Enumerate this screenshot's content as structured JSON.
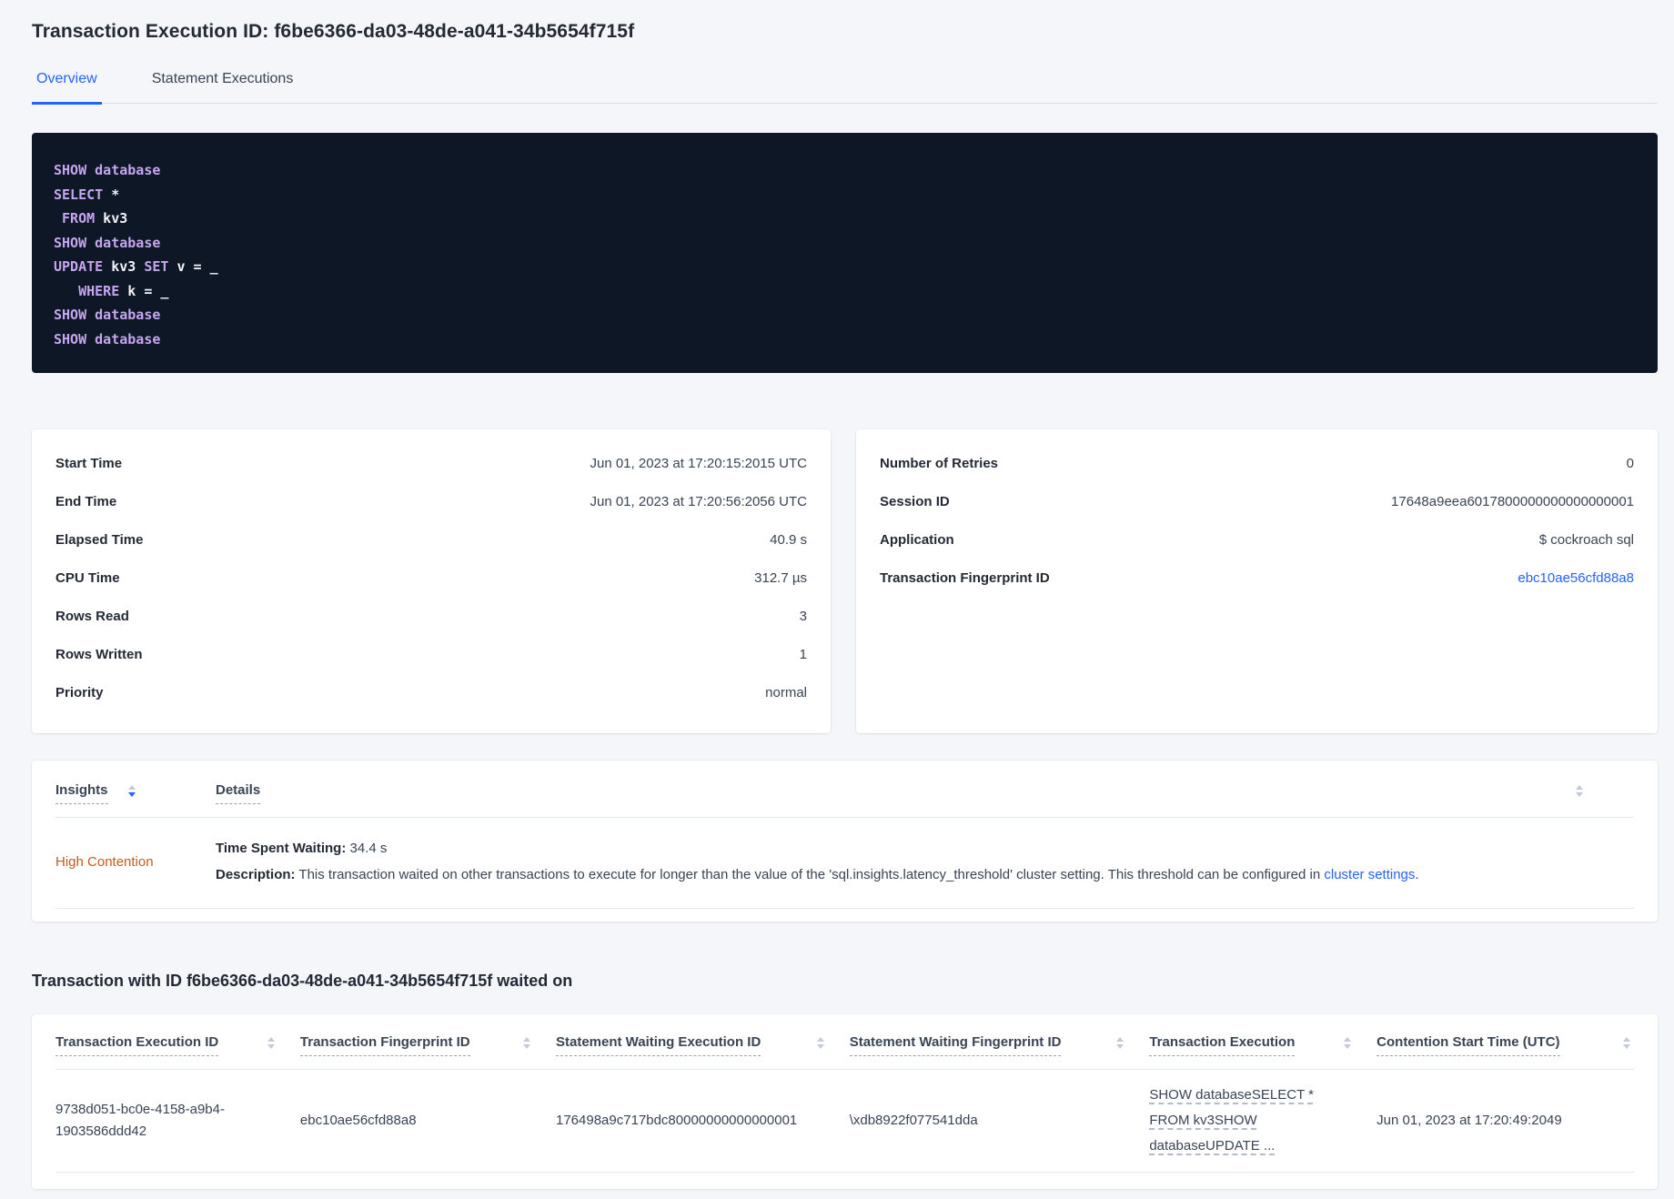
{
  "colors": {
    "accent": "#2562ff",
    "warning": "#c25c18",
    "code_bg": "#0e1726",
    "code_keyword": "#c6a5f1",
    "code_plain": "#f5f3fa"
  },
  "page": {
    "title": "Transaction Execution ID: f6be6366-da03-48de-a041-34b5654f715f",
    "tabs": [
      {
        "label": "Overview"
      },
      {
        "label": "Statement Executions"
      }
    ]
  },
  "sql": {
    "lines": [
      [
        {
          "t": "SHOW ",
          "k": 1
        },
        {
          "t": "database",
          "k": 1
        }
      ],
      [
        {
          "t": "SELECT",
          "k": 1
        },
        {
          "t": " *"
        }
      ],
      [
        {
          "t": " "
        },
        {
          "t": "FROM",
          "k": 1
        },
        {
          "t": " kv3"
        }
      ],
      [
        {
          "t": "SHOW ",
          "k": 1
        },
        {
          "t": "database",
          "k": 1
        }
      ],
      [
        {
          "t": "UPDATE",
          "k": 1
        },
        {
          "t": " kv3 "
        },
        {
          "t": "SET",
          "k": 1
        },
        {
          "t": " v = _"
        }
      ],
      [
        {
          "t": "   "
        },
        {
          "t": "WHERE",
          "k": 1
        },
        {
          "t": " k = _"
        }
      ],
      [
        {
          "t": "SHOW ",
          "k": 1
        },
        {
          "t": "database",
          "k": 1
        }
      ],
      [
        {
          "t": "SHOW ",
          "k": 1
        },
        {
          "t": "database",
          "k": 1
        }
      ]
    ]
  },
  "summary_left": {
    "rows": [
      {
        "label": "Start Time",
        "value": "Jun 01, 2023 at 17:20:15:2015 UTC"
      },
      {
        "label": "End Time",
        "value": "Jun 01, 2023 at 17:20:56:2056 UTC"
      },
      {
        "label": "Elapsed Time",
        "value": "40.9 s"
      },
      {
        "label": "CPU Time",
        "value": "312.7 µs"
      },
      {
        "label": "Rows Read",
        "value": "3"
      },
      {
        "label": "Rows Written",
        "value": "1"
      },
      {
        "label": "Priority",
        "value": "normal"
      }
    ]
  },
  "summary_right": {
    "rows": [
      {
        "label": "Number of Retries",
        "value": "0"
      },
      {
        "label": "Session ID",
        "value": "17648a9eea6017800000000000000001"
      },
      {
        "label": "Application",
        "value": "$ cockroach sql"
      }
    ],
    "fingerprint_label": "Transaction Fingerprint ID",
    "fingerprint_value": "ebc10ae56cfd88a8"
  },
  "insights": {
    "col_insights": "Insights",
    "col_details": "Details",
    "row": {
      "insight": "High Contention",
      "waiting_label": "Time Spent Waiting:",
      "waiting_value": " 34.4 s",
      "description_label": "Description:",
      "description_text": " This transaction waited on other transactions to execute for longer than the value of the 'sql.insights.latency_threshold' cluster setting. This threshold can be configured in ",
      "description_link": "cluster settings",
      "description_suffix": "."
    }
  },
  "waited_on": {
    "title": "Transaction with ID f6be6366-da03-48de-a041-34b5654f715f waited on",
    "columns": [
      "Transaction Execution ID",
      "Transaction Fingerprint ID",
      "Statement Waiting Execution ID",
      "Statement Waiting Fingerprint ID",
      "Transaction Execution",
      "Contention Start Time (UTC)"
    ],
    "row": {
      "transaction_execution_id": "9738d051-bc0e-4158-a9b4-1903586ddd42",
      "transaction_fingerprint_id": "ebc10ae56cfd88a8",
      "statement_waiting_execution_id": "176498a9c717bdc80000000000000001",
      "statement_waiting_fingerprint_id": "\\xdb8922f077541dda",
      "transaction_execution": "SHOW databaseSELECT * FROM kv3SHOW databaseUPDATE ...",
      "contention_start_time": "Jun 01, 2023 at 17:20:49:2049"
    }
  }
}
